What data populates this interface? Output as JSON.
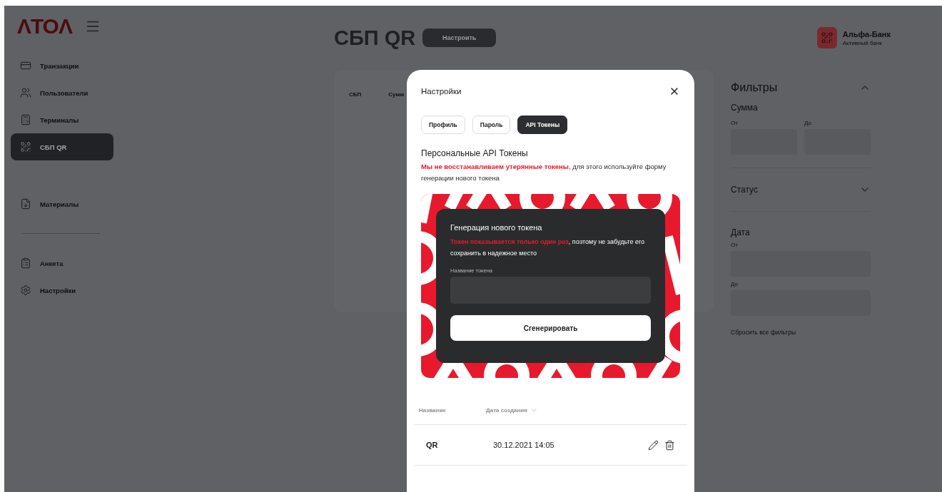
{
  "sidebar": {
    "logo": "ΛТОΛ",
    "groups": [
      [
        {
          "label": "Транзакции",
          "selected": false
        },
        {
          "label": "Пользователи",
          "selected": false
        },
        {
          "label": "Терминалы",
          "selected": false
        },
        {
          "label": "СБП QR",
          "selected": true
        }
      ],
      [
        {
          "label": "Материалы",
          "selected": false
        }
      ],
      [
        {
          "label": "Анкета",
          "selected": false
        },
        {
          "label": "Настройки",
          "selected": false
        }
      ]
    ]
  },
  "header": {
    "title": "СБП QR",
    "button": "Настроить",
    "bank": {
      "name": "Альфа-Банк",
      "status": "Активный банк"
    }
  },
  "table": {
    "columns": [
      "СБП",
      "Сумм"
    ]
  },
  "filters": {
    "title": "Фильтры",
    "expanded": true,
    "sections": [
      {
        "kind": "range-row",
        "title": "Сумма",
        "fields": [
          "От",
          "До"
        ]
      },
      {
        "kind": "dropdown",
        "title": "Статус",
        "expanded": false
      },
      {
        "kind": "range-stack",
        "title": "Дата",
        "fields": [
          "От",
          "До"
        ]
      }
    ],
    "reset": "Сбросить все фильтры"
  },
  "modal": {
    "title": "Настройки",
    "tabs": [
      {
        "label": "Профиль",
        "selected": false
      },
      {
        "label": "Пароль",
        "selected": false
      },
      {
        "label": "API Токены",
        "selected": true
      }
    ],
    "heading": "Персональные API Токены",
    "warning": "**Мы не восстанавливаем утерянные токены**, для этого используйте форму генерации нового токена",
    "generator": {
      "title": "Генерация нового токена",
      "note": "**Токен показывается только один раз**, поэтому не забудьте его сохранить в надежное место",
      "field_label": "Название токена",
      "button": "Сгенерировать"
    },
    "tokens": {
      "columns": [
        {
          "label": "Название",
          "sorted": false
        },
        {
          "label": "Дата создания",
          "sorted": true
        }
      ],
      "rows": [
        {
          "name": "QR",
          "created": "30.12.2021 14:05"
        }
      ]
    }
  }
}
